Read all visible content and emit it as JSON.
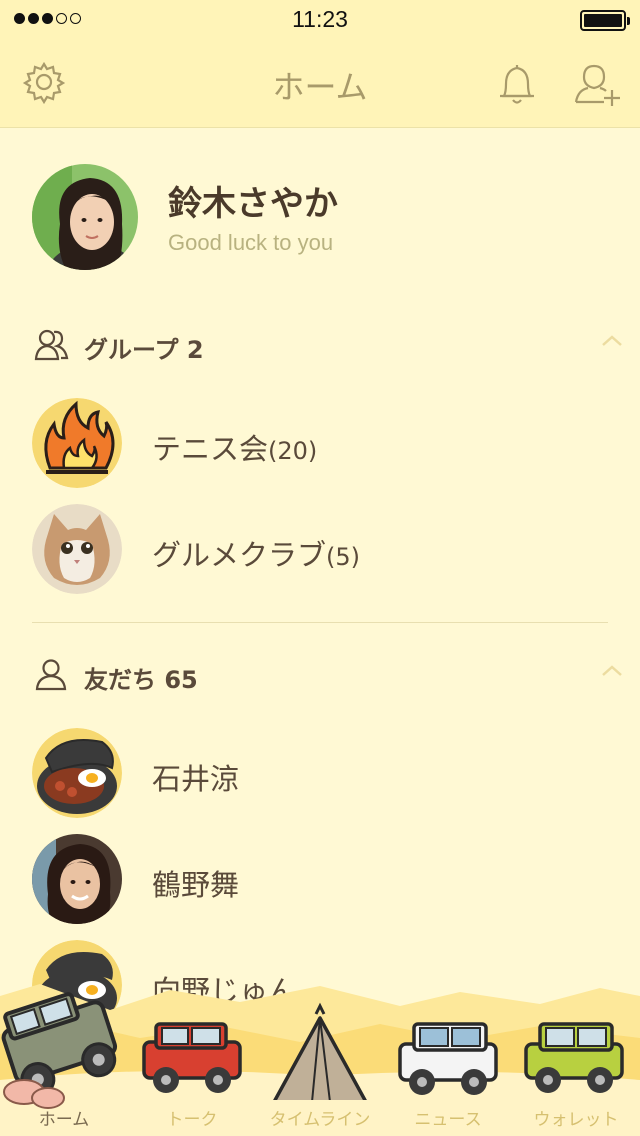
{
  "status_bar": {
    "time": "11:23",
    "signal_bars_filled": 3,
    "signal_bars_total": 5
  },
  "header": {
    "title": "ホーム"
  },
  "profile": {
    "name": "鈴木さやか",
    "status_message": "Good luck to you"
  },
  "groups": {
    "title": "グループ",
    "count": "2",
    "items": [
      {
        "name": "テニス会",
        "count": "(20)"
      },
      {
        "name": "グルメクラブ",
        "count": "(5)"
      }
    ]
  },
  "friends": {
    "title": "友だち",
    "count": "65",
    "items": [
      {
        "name": "石井涼"
      },
      {
        "name": "鶴野舞"
      },
      {
        "name": "向野じゅん"
      }
    ]
  },
  "tabs": [
    {
      "label": "ホーム",
      "active": true
    },
    {
      "label": "トーク",
      "active": false
    },
    {
      "label": "タイムライン",
      "active": false
    },
    {
      "label": "ニュース",
      "active": false
    },
    {
      "label": "ウォレット",
      "active": false
    }
  ],
  "colors": {
    "background": "#fff9d4",
    "header": "#fff4b8",
    "accent": "#e8c040",
    "text": "#5a4a3a",
    "muted": "#b8b280"
  }
}
